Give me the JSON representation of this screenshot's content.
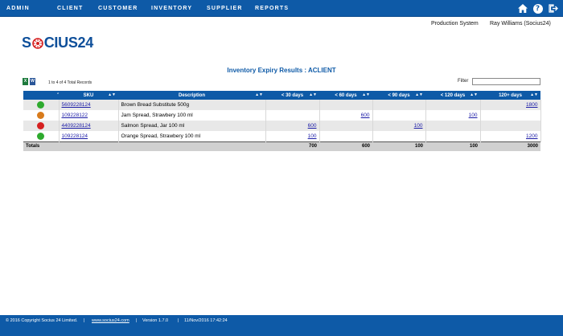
{
  "nav": {
    "items": [
      "ADMIN",
      "CLIENT",
      "CUSTOMER",
      "INVENTORY",
      "SUPPLIER",
      "REPORTS"
    ],
    "icons": [
      "home-icon",
      "help-icon",
      "logout-icon"
    ]
  },
  "header": {
    "system": "Production System",
    "user": "Ray Williams (Socius24)"
  },
  "logo": {
    "s": "S",
    "rest": "CIUS24"
  },
  "title": "Inventory Expiry Results : ACLIENT",
  "records": "1 to 4 of 4 Total Records",
  "filter": {
    "label": "Filter",
    "value": ""
  },
  "table": {
    "columns": [
      "",
      "SKU",
      "Description",
      "< 30 days",
      "< 60 days",
      "< 90 days",
      "< 120 days",
      "120+ days"
    ],
    "rows": [
      {
        "status_color": "#2eaa2e",
        "status": "green",
        "sku": "5609228124",
        "description": "Brown Bread Substitute 500g",
        "d30": "",
        "d60": "",
        "d90": "",
        "d120": "",
        "d120p": "1800"
      },
      {
        "status_color": "#d87b1c",
        "status": "orange",
        "sku": "109228122",
        "description": "Jam Spread, Strawbery 100 ml",
        "d30": "",
        "d60": "600",
        "d90": "",
        "d120": "100",
        "d120p": ""
      },
      {
        "status_color": "#d52020",
        "status": "red",
        "sku": "4409228124",
        "description": "Salmon Spread, Jar 100 ml",
        "d30": "600",
        "d60": "",
        "d90": "100",
        "d120": "",
        "d120p": ""
      },
      {
        "status_color": "#2eaa2e",
        "status": "green",
        "sku": "109228124",
        "description": "Orange Spread, Strawbery 100 ml",
        "d30": "100",
        "d60": "",
        "d90": "",
        "d120": "",
        "d120p": "1200"
      }
    ],
    "totals": {
      "label": "Totals",
      "d30": "700",
      "d60": "600",
      "d90": "100",
      "d120": "100",
      "d120p": "3000"
    }
  },
  "footer": {
    "copyright": "© 2016 Copyright Socius 24 Limited.",
    "link": "www.socius24.com",
    "version": "Version 1.7.0",
    "datetime": "11/Nov/2016 17:42:24"
  },
  "colors": {
    "brand": "#0e5aa7",
    "excel": "#1d7a3c",
    "word": "#2a5699"
  }
}
